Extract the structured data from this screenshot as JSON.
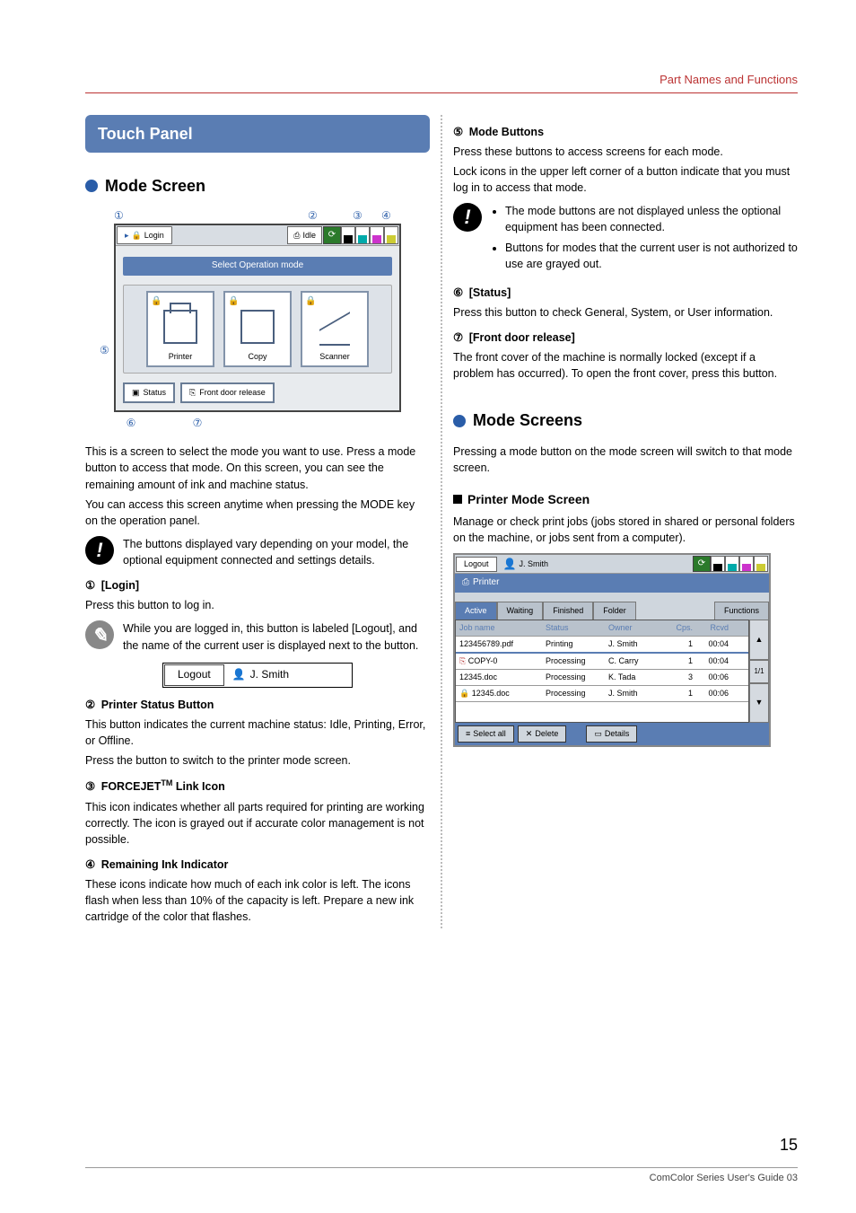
{
  "header": {
    "section": "Part Names and Functions"
  },
  "left": {
    "banner": "Touch Panel",
    "h2": "Mode Screen",
    "fig1": {
      "callouts": {
        "c1": "①",
        "c2": "②",
        "c3": "③",
        "c4": "④",
        "c5": "⑤",
        "c6": "⑥",
        "c7": "⑦"
      },
      "login": "Login",
      "idle": "Idle",
      "select_title": "Select Operation mode",
      "modes": {
        "printer": "Printer",
        "copy": "Copy",
        "scanner": "Scanner"
      },
      "status_btn": "Status",
      "front_door_btn": "Front door release"
    },
    "intro1": "This is a screen to select the mode you want to use. Press a mode button to access that mode. On this screen, you can see the remaining amount of ink and machine status.",
    "intro2": "You can access this screen anytime when pressing the MODE key on the operation panel.",
    "note1": "The buttons displayed vary depending on your model, the optional equipment connected and settings details.",
    "item1": {
      "num": "①",
      "title": "[Login]",
      "body": "Press this button to log in."
    },
    "tip1": "While you are logged in, this button is labeled [Logout], and the name of the current user is displayed next to the button.",
    "logout_sample": {
      "btn": "Logout",
      "user": "J. Smith"
    },
    "item2": {
      "num": "②",
      "title": "Printer Status Button",
      "body1": "This button indicates the current machine status: Idle, Printing, Error, or Offline.",
      "body2": "Press the button to switch to the printer mode screen."
    },
    "item3": {
      "num": "③",
      "title_pre": "FORCEJET",
      "title_sup": "TM",
      "title_post": " Link Icon",
      "body": "This icon indicates whether all parts required for printing are working correctly. The icon is grayed out if accurate color management is not possible."
    },
    "item4": {
      "num": "④",
      "title": "Remaining Ink Indicator",
      "body": "These icons indicate how much of each ink color is left. The icons flash when less than 10% of the capacity is left. Prepare a new ink cartridge of the color that flashes."
    }
  },
  "right": {
    "item5": {
      "num": "⑤",
      "title": "Mode Buttons",
      "body1": "Press these buttons to access screens for each mode.",
      "body2": "Lock icons in the upper left corner of a button indicate that you must log in to access that mode."
    },
    "note2": {
      "b1": "The mode buttons are not displayed unless the optional equipment has been connected.",
      "b2": "Buttons for modes that the current user is not authorized to use are grayed out."
    },
    "item6": {
      "num": "⑥",
      "title": "[Status]",
      "body": "Press this button to check General, System, or User information."
    },
    "item7": {
      "num": "⑦",
      "title": "[Front door release]",
      "body": "The front cover of the machine is normally locked (except if a problem has occurred). To open the front cover, press this button."
    },
    "h2b": "Mode Screens",
    "h2b_body": "Pressing a mode button on the mode screen will switch to that mode screen.",
    "h3": "Printer Mode Screen",
    "h3_body": "Manage or check print jobs (jobs stored in shared or personal folders on the machine, or jobs sent from a computer).",
    "fig2": {
      "logout": "Logout",
      "user": "J. Smith",
      "title": "Printer",
      "tabs": {
        "active": "Active",
        "waiting": "Waiting",
        "finished": "Finished",
        "folder": "Folder",
        "functions": "Functions"
      },
      "head": {
        "job": "Job name",
        "status": "Status",
        "owner": "Owner",
        "cps": "Cps.",
        "rcvd": "Rcvd"
      },
      "rows": [
        {
          "job": "123456789.pdf",
          "status": "Printing",
          "owner": "J. Smith",
          "cps": "1",
          "rcvd": "00:04"
        },
        {
          "job": "COPY-0",
          "status": "Processing",
          "owner": "C. Carry",
          "cps": "1",
          "rcvd": "00:04",
          "icon": "copy"
        },
        {
          "job": "12345.doc",
          "status": "Processing",
          "owner": "K. Tada",
          "cps": "3",
          "rcvd": "00:06"
        },
        {
          "job": "12345.doc",
          "status": "Processing",
          "owner": "J. Smith",
          "cps": "1",
          "rcvd": "00:06",
          "icon": "lock"
        }
      ],
      "page": "1/1",
      "bottom": {
        "select": "Select all",
        "delete": "Delete",
        "details": "Details"
      }
    }
  },
  "footer": {
    "page": "15",
    "line": "ComColor Series User's Guide 03"
  }
}
